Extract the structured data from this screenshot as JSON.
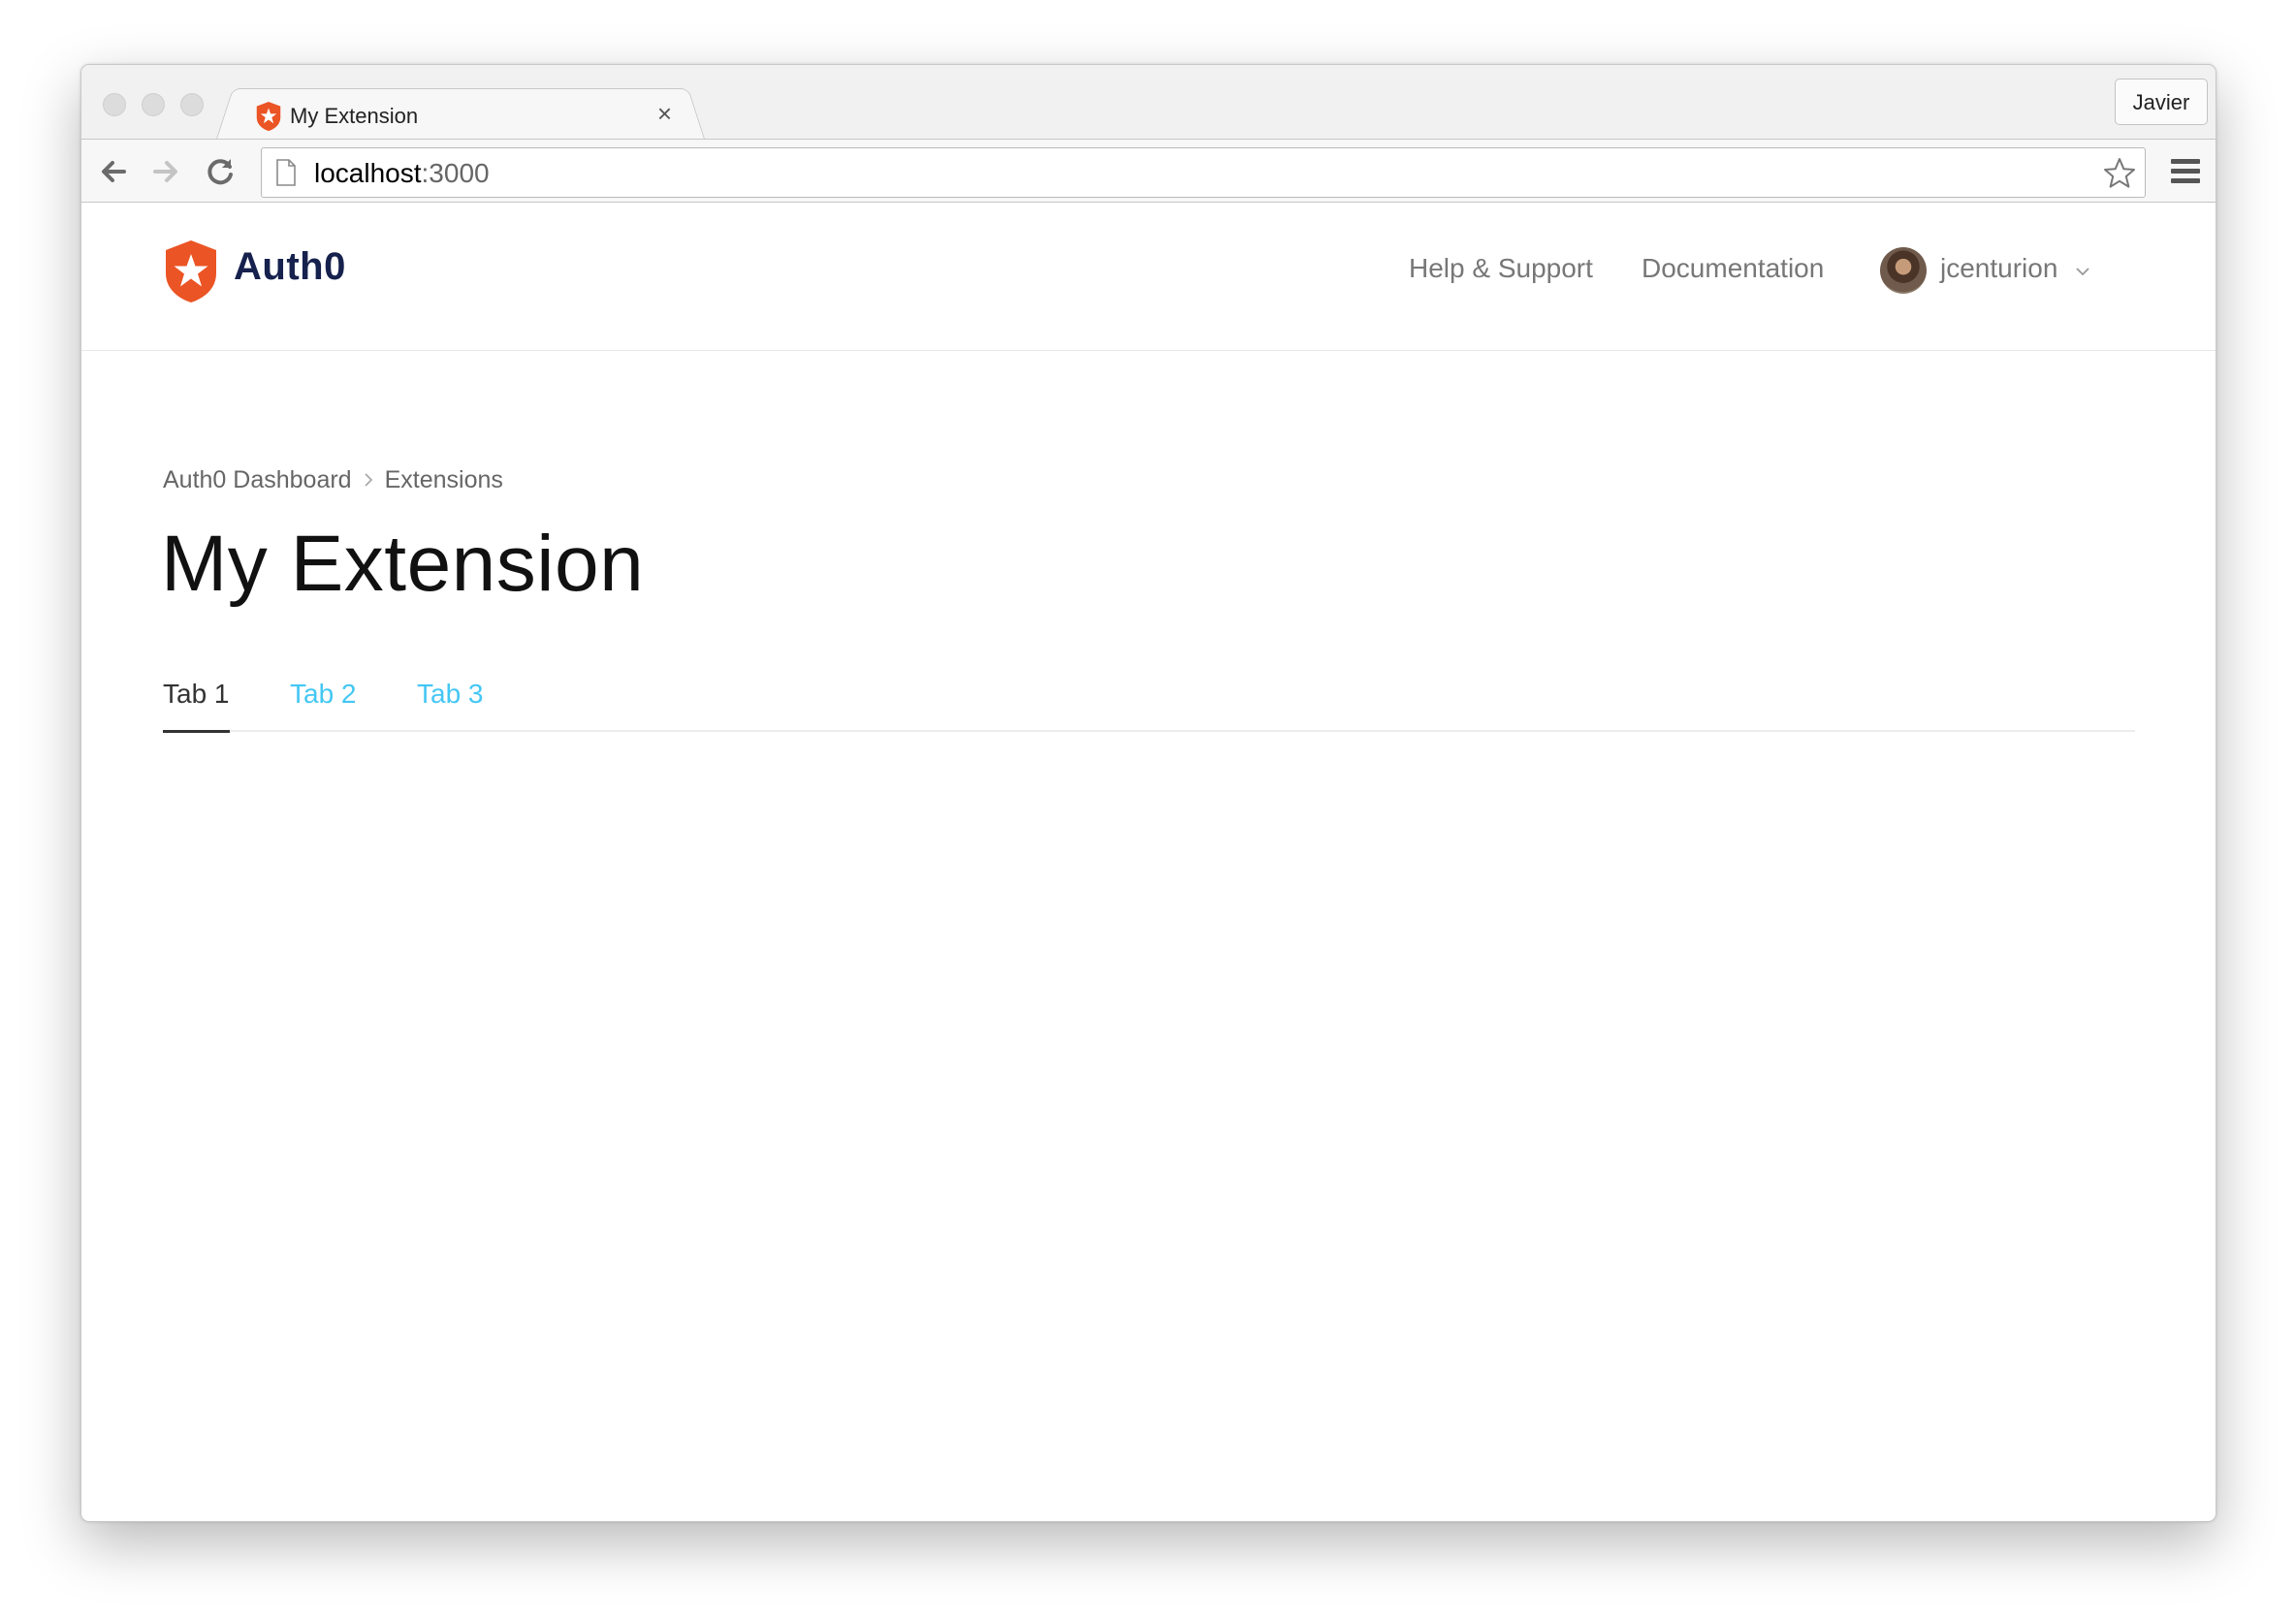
{
  "browser": {
    "tab": {
      "title": "My Extension",
      "close": "×"
    },
    "profile": "Javier",
    "address": {
      "host": "localhost",
      "port": ":3000"
    }
  },
  "header": {
    "brand": "Auth0",
    "links": [
      "Help & Support",
      "Documentation"
    ],
    "user": "jcenturion"
  },
  "breadcrumb": {
    "items": [
      "Auth0 Dashboard",
      "Extensions"
    ]
  },
  "main": {
    "title": "My Extension",
    "tabs": [
      {
        "label": "Tab 1",
        "active": true
      },
      {
        "label": "Tab 2",
        "active": false
      },
      {
        "label": "Tab 3",
        "active": false
      }
    ]
  },
  "colors": {
    "brand_orange": "#eb5424",
    "brand_navy": "#16214d",
    "tab_link": "#44c7f4"
  }
}
